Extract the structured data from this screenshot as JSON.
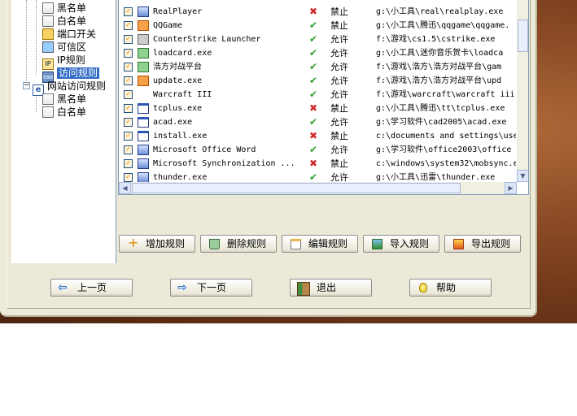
{
  "tree": {
    "items": [
      {
        "label": "黑名单"
      },
      {
        "label": "白名单"
      },
      {
        "label": "端口开关"
      },
      {
        "label": "可信区"
      },
      {
        "label": "IP规则"
      },
      {
        "label": "访问规则"
      },
      {
        "label": "网站访问规则"
      },
      {
        "label": "黑名单"
      },
      {
        "label": "白名单"
      }
    ]
  },
  "rules": [
    {
      "name": "RealPlayer",
      "allowed": false,
      "rule": "禁止",
      "path": "g:\\小工具\\real\\realplay.exe",
      "icon": "realplayer-icon"
    },
    {
      "name": "QQGame",
      "allowed": true,
      "rule": "禁止",
      "path": "g:\\小工具\\腾迅\\qqgame\\qqgame.",
      "icon": "qqgame-icon"
    },
    {
      "name": "CounterStrike Launcher",
      "allowed": true,
      "rule": "允许",
      "path": "f:\\游戏\\cs1.5\\cstrike.exe",
      "icon": "counterstrike-icon"
    },
    {
      "name": "loadcard.exe",
      "allowed": true,
      "rule": "允许",
      "path": "g:\\小工具\\迷你音乐贺卡\\loadca",
      "icon": "loadcard-icon"
    },
    {
      "name": "浩方对战平台",
      "allowed": true,
      "rule": "允许",
      "path": "f:\\游戏\\浩方\\浩方对战平台\\gam",
      "icon": "haofang-icon"
    },
    {
      "name": "update.exe",
      "allowed": true,
      "rule": "允许",
      "path": "f:\\游戏\\浩方\\浩方对战平台\\upd",
      "icon": "update-icon"
    },
    {
      "name": "Warcraft III",
      "allowed": true,
      "rule": "允许",
      "path": "f:\\游戏\\warcraft\\warcraft iii",
      "icon": "warcraft-icon"
    },
    {
      "name": "tcplus.exe",
      "allowed": false,
      "rule": "禁止",
      "path": "g:\\小工具\\腾迅\\tt\\tcplus.exe",
      "icon": "window-icon"
    },
    {
      "name": "acad.exe",
      "allowed": true,
      "rule": "允许",
      "path": "g:\\学习软件\\cad2005\\acad.exe",
      "icon": "window-icon"
    },
    {
      "name": "install.exe",
      "allowed": false,
      "rule": "禁止",
      "path": "c:\\documents and settings\\use",
      "icon": "window-icon"
    },
    {
      "name": "Microsoft Office Word",
      "allowed": true,
      "rule": "允许",
      "path": "g:\\学习软件\\office2003\\office",
      "icon": "word-icon"
    },
    {
      "name": "Microsoft Synchronization ...",
      "allowed": false,
      "rule": "禁止",
      "path": "c:\\windows\\system32\\mobsync.e",
      "icon": "sync-icon"
    },
    {
      "name": "thunder.exe",
      "allowed": true,
      "rule": "允许",
      "path": "g:\\小工具\\迅雷\\thunder.exe",
      "icon": "thunder-icon"
    }
  ],
  "actions": {
    "add": "增加规则",
    "delete": "删除规则",
    "edit": "编辑规则",
    "import": "导入规则",
    "export": "导出规则"
  },
  "nav": {
    "prev": "上一页",
    "next": "下一页",
    "exit": "退出",
    "help": "帮助"
  },
  "colors": {
    "selection": "#316ac5",
    "allow": "#2da02d",
    "deny": "#d32a2a"
  }
}
